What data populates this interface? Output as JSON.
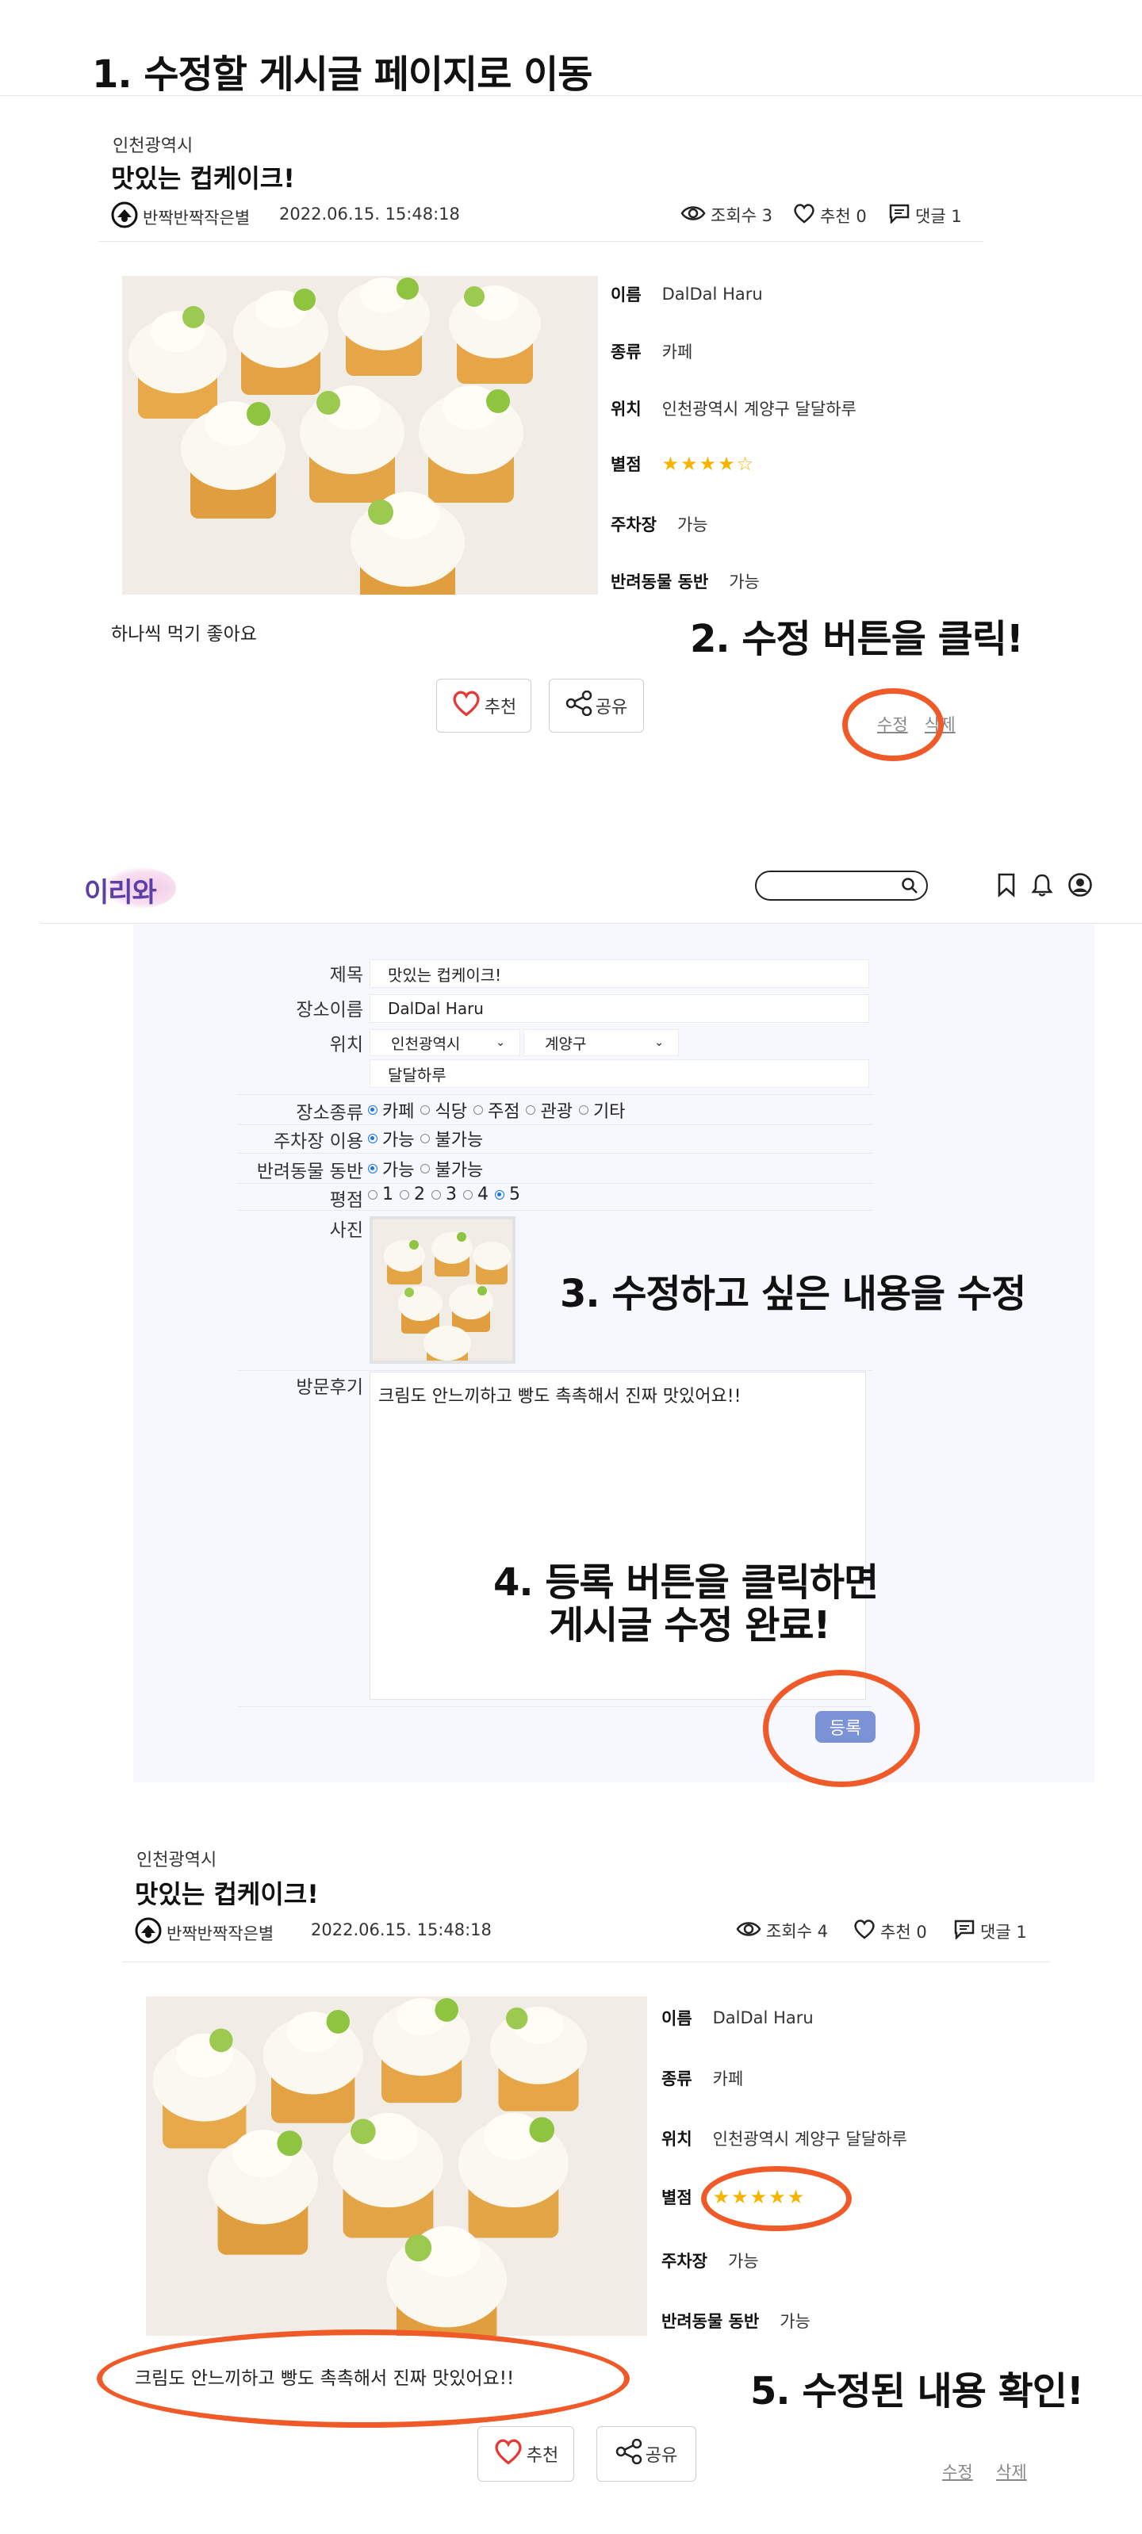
{
  "steps": {
    "s1": "1. 수정할 게시글 페이지로 이동",
    "s2": "2. 수정 버튼을 클릭!",
    "s3": "3. 수정하고 싶은 내용을 수정",
    "s4a": "4. 등록 버튼을 클릭하면",
    "s4b": "게시글 수정 완료!",
    "s5": "5. 수정된 내용 확인!"
  },
  "post_before": {
    "region": "인천광역시",
    "title": "맛있는 컵케이크!",
    "author": "반짝반짝작은별",
    "datetime": "2022.06.15. 15:48:18",
    "views": "조회수 3",
    "likes": "추천 0",
    "comments": "댓글 1",
    "info": {
      "name_k": "이름",
      "name_v": "DalDal Haru",
      "type_k": "종류",
      "type_v": "카페",
      "loc_k": "위치",
      "loc_v": "인천광역시 계양구 달달하루",
      "rating_k": "별점",
      "rating_stars": "★★★★☆",
      "rating": 4,
      "parking_k": "주차장",
      "parking_v": "가능",
      "pet_k": "반려동물 동반",
      "pet_v": "가능"
    },
    "review": "하나씩 먹기 좋아요",
    "like_btn": "추천",
    "share_btn": "공유",
    "edit": "수정",
    "delete": "삭제"
  },
  "header": {
    "logo": "이리와",
    "search_placeholder": ""
  },
  "form": {
    "title_label": "제목",
    "title_value": "맛있는 컵케이크!",
    "place_label": "장소이름",
    "place_value": "DalDal Haru",
    "loc_label": "위치",
    "city": "인천광역시",
    "district": "계양구",
    "loc_detail": "달달하루",
    "type_label": "장소종류",
    "type_options": [
      "카페",
      "식당",
      "주점",
      "관광",
      "기타"
    ],
    "type_selected": "카페",
    "parking_label": "주차장 이용",
    "parking_options": [
      "가능",
      "불가능"
    ],
    "parking_selected": "가능",
    "pet_label": "반려동물 동반",
    "pet_options": [
      "가능",
      "불가능"
    ],
    "pet_selected": "가능",
    "rating_label": "평점",
    "rating_options": [
      "1",
      "2",
      "3",
      "4",
      "5"
    ],
    "rating_selected": "5",
    "photo_label": "사진",
    "review_label": "방문후기",
    "review_value": "크림도 안느끼하고 빵도 촉촉해서 진짜 맛있어요!!",
    "submit": "등록"
  },
  "post_after": {
    "region": "인천광역시",
    "title": "맛있는 컵케이크!",
    "author": "반짝반짝작은별",
    "datetime": "2022.06.15. 15:48:18",
    "views": "조회수 4",
    "likes": "추천 0",
    "comments": "댓글 1",
    "info": {
      "name_k": "이름",
      "name_v": "DalDal Haru",
      "type_k": "종류",
      "type_v": "카페",
      "loc_k": "위치",
      "loc_v": "인천광역시 계양구 달달하루",
      "rating_k": "별점",
      "rating_stars": "★★★★★",
      "rating": 5,
      "parking_k": "주차장",
      "parking_v": "가능",
      "pet_k": "반려동물 동반",
      "pet_v": "가능"
    },
    "review": "크림도 안느끼하고 빵도 촉촉해서 진짜 맛있어요!!",
    "like_btn": "추천",
    "share_btn": "공유",
    "edit": "수정",
    "delete": "삭제"
  },
  "colors": {
    "highlight": "#f05a28",
    "submit": "#7b93d6",
    "star": "#f6b400",
    "form_bg": "#f6f8fd"
  }
}
